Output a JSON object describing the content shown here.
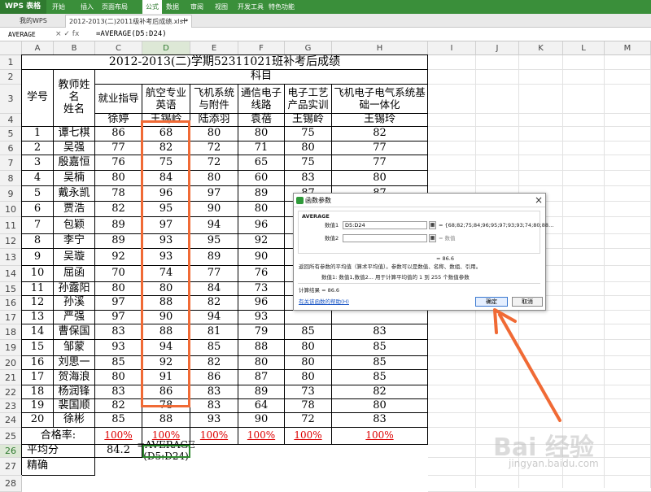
{
  "app": {
    "name": "WPS 表格",
    "menus": [
      "开始",
      "插入",
      "页面布局",
      "公式",
      "数据",
      "审阅",
      "视图",
      "开发工具",
      "特色功能"
    ],
    "active_menu": "公式"
  },
  "tabs": {
    "home": "我的WPS",
    "file": "2012-2013(二)2011级补考后成绩.xls *",
    "add": "+"
  },
  "formula_bar": {
    "name_box": "AVERAGE",
    "icons": "× ✓ fx",
    "formula": "=AVERAGE(D5:D24)"
  },
  "columns": [
    "A",
    "B",
    "C",
    "D",
    "E",
    "F",
    "G",
    "H",
    "I",
    "J",
    "K",
    "L",
    "M"
  ],
  "rows": [
    "1",
    "2",
    "3",
    "4",
    "5",
    "6",
    "7",
    "8",
    "9",
    "10",
    "11",
    "12",
    "13",
    "14",
    "15",
    "16",
    "17",
    "18",
    "19",
    "20",
    "21",
    "22",
    "23",
    "24",
    "25",
    "26",
    "27",
    "28"
  ],
  "sheet": {
    "title": "2012-2013(二)学期52311021班补考后成绩",
    "subject_header": "科目",
    "col_id": "学号",
    "col_teacher": "教师姓名\n姓名",
    "subjects": [
      "就业指导",
      "航空专业英语",
      "飞机系统与附件",
      "通信电子线路",
      "电子工艺产品实训",
      "飞机电子电气系统基础一体化"
    ],
    "teachers": [
      "徐婷",
      "王锡岭",
      "陆添羽",
      "袁蓓",
      "王锡岭",
      "王锡玲"
    ],
    "students": [
      {
        "id": "1",
        "name": "谭七棋",
        "scores": [
          "86",
          "68",
          "80",
          "80",
          "75",
          "82"
        ]
      },
      {
        "id": "2",
        "name": "吴强",
        "scores": [
          "77",
          "82",
          "72",
          "71",
          "80",
          "77"
        ]
      },
      {
        "id": "3",
        "name": "殷嘉恒",
        "scores": [
          "76",
          "75",
          "72",
          "65",
          "75",
          "77"
        ]
      },
      {
        "id": "4",
        "name": "吴楠",
        "scores": [
          "80",
          "84",
          "80",
          "60",
          "83",
          "80"
        ]
      },
      {
        "id": "5",
        "name": "戴永凯",
        "scores": [
          "78",
          "96",
          "97",
          "89",
          "87",
          "87"
        ]
      },
      {
        "id": "6",
        "name": "贾浩",
        "scores": [
          "82",
          "95",
          "90",
          "80",
          "",
          ""
        ]
      },
      {
        "id": "7",
        "name": "包颖",
        "scores": [
          "89",
          "97",
          "94",
          "96",
          "",
          ""
        ]
      },
      {
        "id": "8",
        "name": "李宁",
        "scores": [
          "89",
          "93",
          "95",
          "92",
          "",
          ""
        ]
      },
      {
        "id": "9",
        "name": "吴璇",
        "scores": [
          "92",
          "93",
          "89",
          "90",
          "",
          ""
        ]
      },
      {
        "id": "10",
        "name": "屈函",
        "scores": [
          "70",
          "74",
          "77",
          "76",
          "",
          ""
        ]
      },
      {
        "id": "11",
        "name": "孙露阳",
        "scores": [
          "80",
          "80",
          "84",
          "73",
          "",
          ""
        ]
      },
      {
        "id": "12",
        "name": "孙溪",
        "scores": [
          "97",
          "88",
          "82",
          "96",
          "",
          ""
        ]
      },
      {
        "id": "13",
        "name": "严强",
        "scores": [
          "97",
          "90",
          "94",
          "93",
          "",
          ""
        ]
      },
      {
        "id": "14",
        "name": "曹保国",
        "scores": [
          "83",
          "88",
          "81",
          "79",
          "85",
          "83"
        ]
      },
      {
        "id": "15",
        "name": "邹蒙",
        "scores": [
          "93",
          "94",
          "85",
          "88",
          "80",
          "85"
        ]
      },
      {
        "id": "16",
        "name": "刘思一",
        "scores": [
          "85",
          "92",
          "82",
          "80",
          "80",
          "85"
        ]
      },
      {
        "id": "17",
        "name": "贺海浪",
        "scores": [
          "80",
          "91",
          "86",
          "87",
          "80",
          "85"
        ]
      },
      {
        "id": "18",
        "name": "杨润锋",
        "scores": [
          "83",
          "86",
          "83",
          "89",
          "73",
          "82"
        ]
      },
      {
        "id": "19",
        "name": "裴国顺",
        "scores": [
          "82",
          "78",
          "83",
          "64",
          "78",
          "80"
        ]
      },
      {
        "id": "20",
        "name": "徐彬",
        "scores": [
          "85",
          "88",
          "93",
          "90",
          "72",
          "83"
        ]
      }
    ],
    "pass_label": "合格率:",
    "pass_rates": [
      "100%",
      "100%",
      "100%",
      "100%",
      "100%",
      "100%"
    ],
    "avg_label": "平均分",
    "avg_value": "84.2",
    "avg_formula": "=AVERAGE\n(D5:D24)",
    "row27_label": "精确"
  },
  "dialog": {
    "title": "函数参数",
    "close": "×",
    "function_name": "AVERAGE",
    "arg1_label": "数值1",
    "arg1_value": "D5:D24",
    "arg1_result": "= {68;82;75;84;96;95;97;93;93;74;80;88…",
    "arg2_label": "数值2",
    "arg2_result": "= 数值",
    "total_result": "= 86.6",
    "description": "返回所有参数的平均值（算术平均值）。参数可以是数值、名称、数组、引用。",
    "arg_help": "数值1:   数值1,数值2... 用于计算平均值的 1 到 255 个数值参数",
    "calc_result": "计算结果 = 86.6",
    "help_link": "有关该函数的帮助(H)",
    "ok": "确定",
    "cancel": "取消"
  },
  "watermark": {
    "main": "Bai 经验",
    "sub": "jingyan.baidu.com"
  },
  "colors": {
    "accent": "#3a8f3a",
    "highlight": "#f06a35",
    "pass": "#dd0000"
  }
}
